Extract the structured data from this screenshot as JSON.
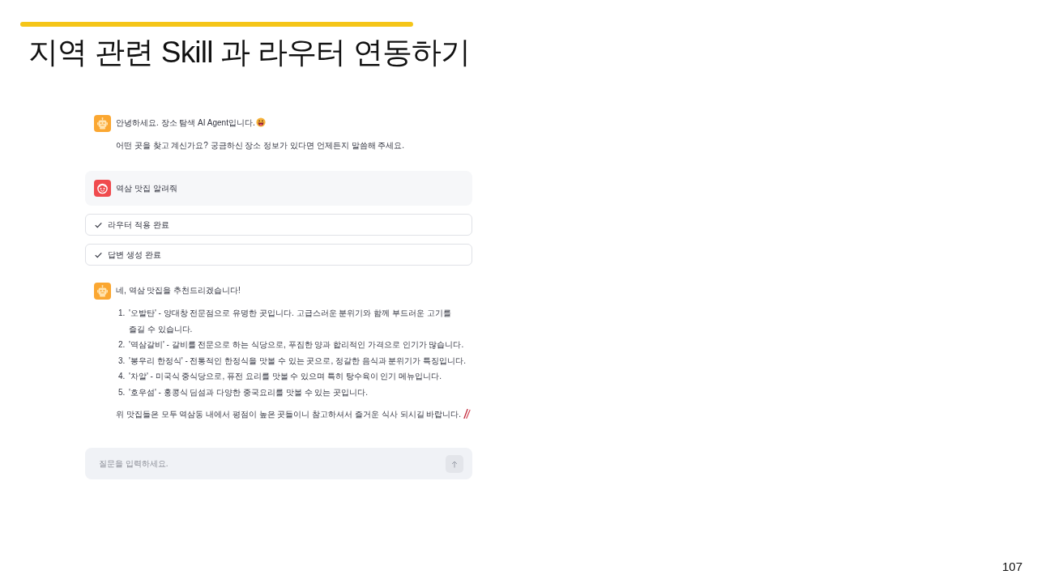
{
  "slide": {
    "title": "지역 관련 Skill 과 라우터 연동하기",
    "page_number": "107"
  },
  "chat": {
    "messages": [
      {
        "kind": "assistant",
        "blocks": [
          {
            "kind": "greeting",
            "text": "안녕하세요. 장소 탐색 AI Agent입니다."
          },
          {
            "kind": "paragraph",
            "text": "어떤 곳을 찾고 계신가요? 궁금하신 장소 정보가 있다면 언제든지 말씀해 주세요."
          }
        ]
      },
      {
        "kind": "user",
        "blocks": [
          {
            "kind": "paragraph",
            "text": "역삼 맛집 알려줘"
          }
        ]
      },
      {
        "kind": "status",
        "label": "라우터 적용 완료",
        "complete": true
      },
      {
        "kind": "status",
        "label": "답변 생성 완료",
        "complete": true
      },
      {
        "kind": "assistant",
        "blocks": [
          {
            "kind": "paragraph",
            "text": "네, 역삼 맛집을 추천드리겠습니다!"
          },
          {
            "kind": "list",
            "items": [
              {
                "number": "1.",
                "text": "'오발탄' - 양대창 전문점으로 유명한 곳입니다. 고급스러운 분위기와 함께 부드러운 고기를 즐길 수 있습니다."
              },
              {
                "number": "2.",
                "text": "'역삼갈비' - 갈비를 전문으로 하는 식당으로, 푸짐한 양과 합리적인 가격으로 인기가 많습니다."
              },
              {
                "number": "3.",
                "text": "'봉우리 한정식' - 전통적인 한정식을 맛볼 수 있는 곳으로, 정갈한 음식과 분위기가 특징입니다."
              },
              {
                "number": "4.",
                "text": "'차알' - 미국식 중식당으로, 퓨전 요리를 맛볼 수 있으며 특히 탕수육이 인기 메뉴입니다."
              },
              {
                "number": "5.",
                "text": "'호우섬' - 홍콩식 딤섬과 다양한 중국요리를 맛볼 수 있는 곳입니다."
              }
            ]
          },
          {
            "kind": "closing",
            "text": "위 맛집들은 모두 역삼동 내에서 평점이 높은 곳들이니 참고하셔서 즐거운 식사 되시길 바랍니다."
          }
        ]
      }
    ],
    "input": {
      "placeholder": "질문을 입력하세요."
    }
  }
}
